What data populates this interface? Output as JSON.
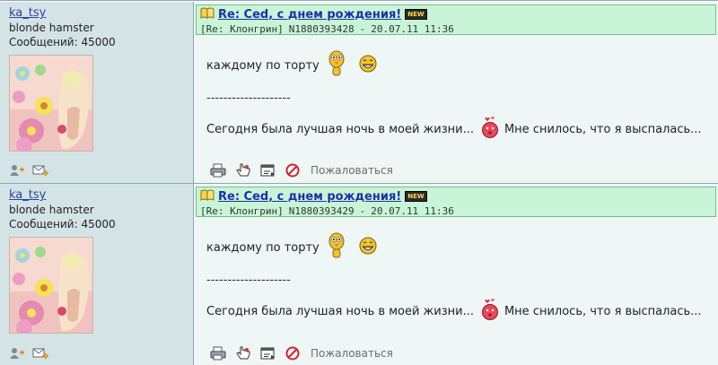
{
  "posts": [
    {
      "author": "ka_tsy",
      "status": "blonde hamster",
      "messages_label": "Сообщений:",
      "messages_count": "45000",
      "title": "Re: Ced, с днем рождения!",
      "new_badge": "NEW",
      "reply_to": "[Re: Клонгрин]",
      "post_id": "N1880393428",
      "datetime": "20.07.11 11:36",
      "line1": "каждому по торту",
      "separator": "--------------------",
      "line3_a": "Сегодня была лучшая ночь в моей жизни...",
      "line3_b": "Мне снилось, что я выспалась...",
      "complain_label": "Пожаловаться"
    },
    {
      "author": "ka_tsy",
      "status": "blonde hamster",
      "messages_label": "Сообщений:",
      "messages_count": "45000",
      "title": "Re: Ced, с днем рождения!",
      "new_badge": "NEW",
      "reply_to": "[Re: Клонгрин]",
      "post_id": "N1880393429",
      "datetime": "20.07.11 11:36",
      "line1": "каждому по торту",
      "separator": "--------------------",
      "line3_a": "Сегодня была лучшая ночь в моей жизни...",
      "line3_b": "Мне снилось, что я выспалась...",
      "complain_label": "Пожаловаться"
    }
  ],
  "icons": {
    "title_icon": "open-book-icon",
    "add_friend": "add-user-icon",
    "send_message": "envelope-arrow-icon",
    "print": "printer-icon",
    "quote": "hand-pointer-icon",
    "reply": "reply-window-icon",
    "complain": "no-entry-icon",
    "smiley1": "chick-smiley-icon",
    "smiley2": "grin-smiley-icon",
    "smiley3": "kiss-smiley-icon"
  },
  "colors": {
    "left_bg": "#d4e4e6",
    "right_bg": "#eef6f6",
    "header_bg": "#c8f5d8",
    "link": "#1d2fa8"
  }
}
